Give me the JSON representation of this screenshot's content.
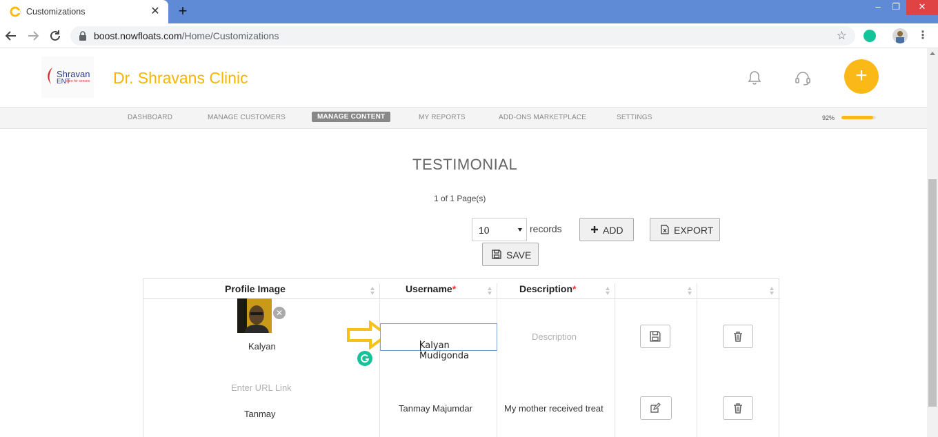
{
  "browser": {
    "tab_title": "Customizations",
    "tab_close": "✕",
    "new_tab": "+",
    "url_domain": "boost.nowfloats.com",
    "url_path": "/Home/Customizations",
    "window_min": "–",
    "window_restore": "❐",
    "window_close": "✕"
  },
  "header": {
    "logo_name": "Shravan",
    "logo_sub": "ENT",
    "logo_tag": "care for senses",
    "clinic_name": "Dr. Shravans Clinic",
    "fab_label": "+"
  },
  "nav": {
    "items": [
      {
        "label": "DASHBOARD"
      },
      {
        "label": "MANAGE CUSTOMERS"
      },
      {
        "label": "MANAGE CONTENT"
      },
      {
        "label": "MY REPORTS"
      },
      {
        "label": "ADD-ONS MARKETPLACE"
      },
      {
        "label": "SETTINGS"
      }
    ],
    "active_index": 2,
    "progress_text": "92%",
    "progress_value": 0.92
  },
  "main": {
    "title": "TESTIMONIAL",
    "pages": "1 of 1 Page(s)",
    "page_size": "10",
    "records_label": "records",
    "add_label": "ADD",
    "export_label": "EXPORT",
    "save_label": "SAVE"
  },
  "table": {
    "columns": [
      {
        "label": "Profile Image",
        "required": ""
      },
      {
        "label": "Username",
        "required": "*"
      },
      {
        "label": "Description",
        "required": "*"
      },
      {
        "label": "",
        "required": ""
      },
      {
        "label": "",
        "required": ""
      }
    ],
    "rows": [
      {
        "profile_name": "Kalyan",
        "username": "Kalyan Mudigonda",
        "description_placeholder": "Description",
        "action": "save"
      },
      {
        "url_placeholder": "Enter URL Link",
        "profile_name": "Tanmay",
        "username": "Tanmay Majumdar",
        "description": "My mother received treat",
        "action": "edit"
      }
    ]
  },
  "colors": {
    "accent": "#fbb917",
    "clinic_name": "#f7b500",
    "required": "#e53935",
    "chrome_tabbar": "#5f8bd6",
    "grammarly": "#15c39a"
  }
}
